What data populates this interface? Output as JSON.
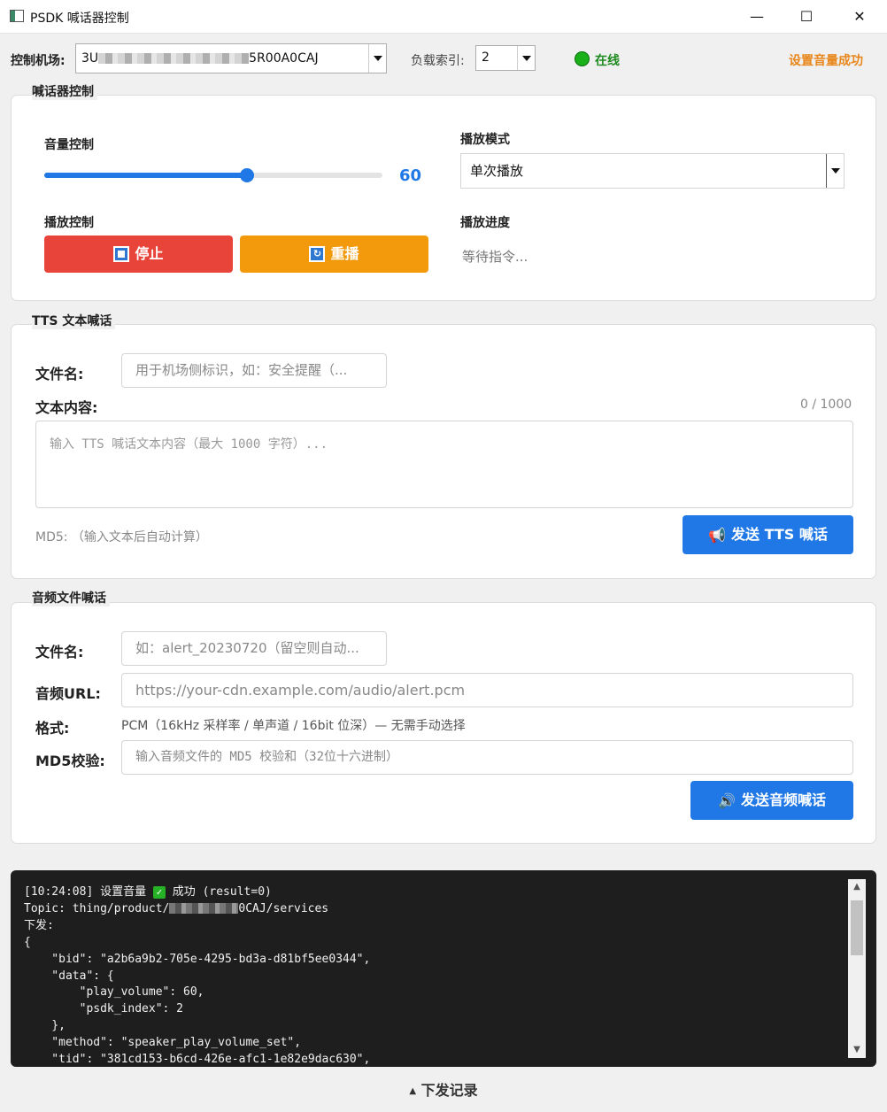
{
  "window": {
    "title": "PSDK 喊话器控制",
    "minimize": "—",
    "maximize": "☐",
    "close": "✕"
  },
  "toolbar": {
    "dock_label": "控制机场:",
    "dock_value_prefix": "3U",
    "dock_value_suffix": "5R00A0CAJ",
    "payload_label": "负载索引:",
    "payload_value": "2",
    "status_text": "在线",
    "status_color": "#19b019",
    "message": "设置音量成功",
    "message_color": "#e8861a"
  },
  "speaker": {
    "legend": "喊话器控制",
    "volume_label": "音量控制",
    "volume_value": "60",
    "volume": 60,
    "mode_label": "播放模式",
    "mode_value": "单次播放",
    "play_control_label": "播放控制",
    "stop_label": "停止",
    "replay_label": "重播",
    "progress_label": "播放进度",
    "progress_text": "等待指令..."
  },
  "tts": {
    "legend": "TTS 文本喊话",
    "filename_label": "文件名:",
    "filename_placeholder": "用于机场侧标识，如：安全提醒（...",
    "content_label": "文本内容:",
    "char_count": "0 / 1000",
    "content_placeholder": "输入 TTS 喊话文本内容（最大 1000 字符）...",
    "md5_text": "MD5: （输入文本后自动计算）",
    "send_label": "发送 TTS 喊话"
  },
  "audio": {
    "legend": "音频文件喊话",
    "filename_label": "文件名:",
    "filename_placeholder": "如：alert_20230720（留空则自动...",
    "url_label": "音频URL:",
    "url_placeholder": "https://your-cdn.example.com/audio/alert.pcm",
    "format_label": "格式:",
    "format_text": "PCM（16kHz 采样率 / 单声道 / 16bit 位深）— 无需手动选择",
    "md5_label": "MD5校验:",
    "md5_placeholder": "输入音频文件的 MD5 校验和（32位十六进制）",
    "send_label": "发送音频喊话"
  },
  "log": {
    "line1_time": "[10:24:08] 设置音量 ",
    "line1_check": "✓",
    "line1_rest": " 成功 (result=0)",
    "topic_prefix": "Topic: thing/product/",
    "topic_suffix": "0CAJ/services",
    "lines": [
      "下发:",
      "{",
      "    \"bid\": \"a2b6a9b2-705e-4295-bd3a-d81bf5ee0344\",",
      "    \"data\": {",
      "        \"play_volume\": 60,",
      "        \"psdk_index\": 2",
      "    },",
      "    \"method\": \"speaker_play_volume_set\",",
      "    \"tid\": \"381cd153-b6cd-426e-afc1-1e82e9dac630\","
    ]
  },
  "footer": {
    "arrow": "▲",
    "label": "下发记录"
  },
  "colors": {
    "stop": "#e8443a",
    "replay": "#f29a0c",
    "primary": "#1f78e6",
    "slider_accent": "#1f78e6"
  }
}
